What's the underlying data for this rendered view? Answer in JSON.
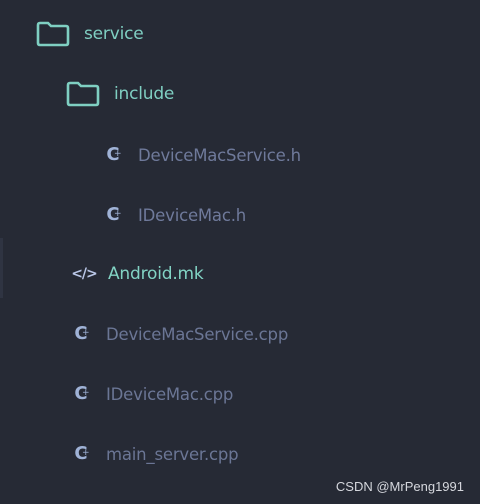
{
  "tree": {
    "folder_service": {
      "label": "service",
      "icon": "folder-icon"
    },
    "folder_include": {
      "label": "include",
      "icon": "folder-icon"
    },
    "file_devicemacservice_h": {
      "label": "DeviceMacService.h",
      "icon": "c-header-icon"
    },
    "file_idevicemac_h": {
      "label": "IDeviceMac.h",
      "icon": "c-header-icon"
    },
    "file_android_mk": {
      "label": "Android.mk",
      "icon": "code-icon"
    },
    "file_devicemacservice_cpp": {
      "label": "DeviceMacService.cpp",
      "icon": "c-file-icon"
    },
    "file_idevicemac_cpp": {
      "label": "IDeviceMac.cpp",
      "icon": "c-file-icon"
    },
    "file_main_server_cpp": {
      "label": "main_server.cpp",
      "icon": "c-file-icon"
    }
  },
  "icons": {
    "c_letter": "C",
    "c_dot": "+",
    "code_symbol": "</>"
  },
  "watermark": "CSDN @MrPeng1991",
  "colors": {
    "background": "#262a35",
    "folder": "#7fcfc2",
    "file_text": "#6f7a9b",
    "icon": "#9fb2d6"
  }
}
